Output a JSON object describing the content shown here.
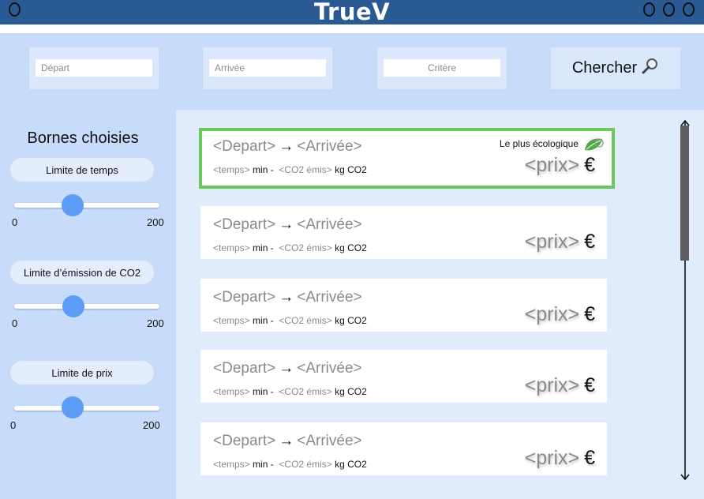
{
  "app": {
    "title": "TrueV",
    "left_circles": 1,
    "right_circles": 3
  },
  "search": {
    "depart_placeholder": "Départ",
    "arrivee_placeholder": "Arrivée",
    "critere_placeholder": "Critère",
    "button_label": "Chercher",
    "button_icon": "magnifier-icon"
  },
  "sidebar": {
    "title": "Bornes choisies",
    "filters": [
      {
        "label": "Limite de temps",
        "min": "0",
        "max": "200",
        "value_fraction": 0.4
      },
      {
        "label": "Limite d’émission de CO2",
        "min": "0",
        "max": "200",
        "value_fraction": 0.4
      },
      {
        "label": "Limite de prix",
        "min": "0",
        "max": "200",
        "value_fraction": 0.4
      }
    ]
  },
  "results": {
    "best_badge": "Le plus écologique",
    "best_icon": "leaf-icon",
    "highlight_color": "#6ac95a",
    "items": [
      {
        "depart": "<Depart>",
        "arrow": "→",
        "arrivee": "<Arrivée>",
        "temps": "<temps>",
        "min_label": "min -",
        "co2": "<CO2 émis>",
        "co2_unit": "kg CO2",
        "prix": "<prix>",
        "currency": "€"
      },
      {
        "depart": "<Depart>",
        "arrow": "→",
        "arrivee": "<Arrivée>",
        "temps": "<temps>",
        "min_label": "min -",
        "co2": "<CO2 émis>",
        "co2_unit": "kg CO2",
        "prix": "<prix>",
        "currency": "€"
      },
      {
        "depart": "<Depart>",
        "arrow": "→",
        "arrivee": "<Arrivée>",
        "temps": "<temps>",
        "min_label": "min -",
        "co2": "<CO2 émis>",
        "co2_unit": "kg CO2",
        "prix": "<prix>",
        "currency": "€"
      },
      {
        "depart": "<Depart>",
        "arrow": "→",
        "arrivee": "<Arrivée>",
        "temps": "<temps>",
        "min_label": "min -",
        "co2": "<CO2 émis>",
        "co2_unit": "kg CO2",
        "prix": "<prix>",
        "currency": "€"
      },
      {
        "depart": "<Depart>",
        "arrow": "→",
        "arrivee": "<Arrivée>",
        "temps": "<temps>",
        "min_label": "min -",
        "co2": "<CO2 émis>",
        "co2_unit": "kg CO2",
        "prix": "<prix>",
        "currency": "€"
      }
    ]
  },
  "colors": {
    "header": "#2a5a93",
    "panel": "#c7dcfb",
    "main_bg": "#e0ebfc",
    "slider_knob": "#5c9cf6"
  }
}
